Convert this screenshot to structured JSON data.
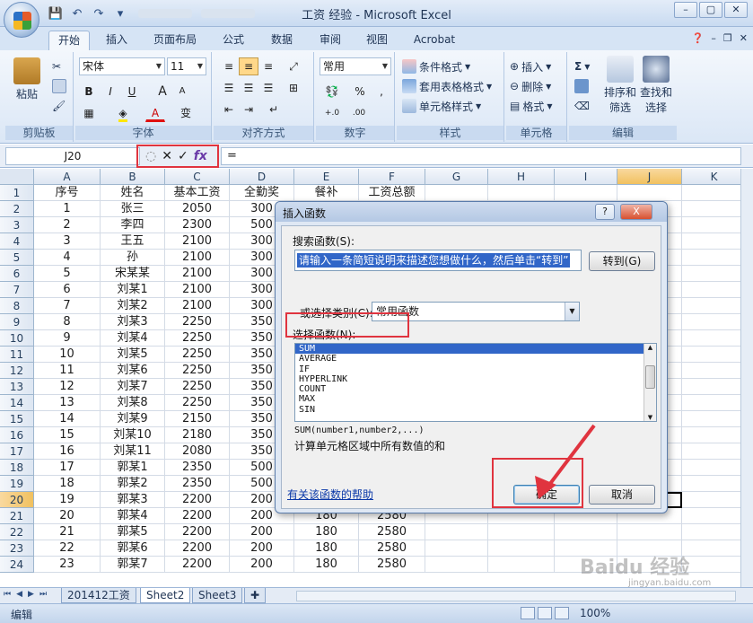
{
  "window": {
    "title": "工资 经验 - Microsoft Excel",
    "controls": [
      "–",
      "▢",
      "✕"
    ]
  },
  "ribbon": {
    "tabs": [
      "开始",
      "插入",
      "页面布局",
      "公式",
      "数据",
      "审阅",
      "视图",
      "Acrobat"
    ],
    "active_tab": "开始",
    "clipboard": {
      "paste": "粘贴",
      "label": "剪贴板"
    },
    "font": {
      "name": "宋体",
      "size": "11",
      "label": "字体",
      "bold": "B",
      "italic": "I",
      "underline": "U",
      "grow": "A",
      "shrink": "A",
      "color": "A",
      "phonetic": "变"
    },
    "alignment": {
      "label": "对齐方式"
    },
    "number": {
      "format": "常用",
      "percent": "%",
      "comma": ",",
      "inc": "+.0",
      "dec": ".00",
      "label": "数字"
    },
    "styles": {
      "conditional": "条件格式",
      "table": "套用表格格式",
      "cell": "单元格样式",
      "label": "样式"
    },
    "cells": {
      "insert": "插入",
      "delete": "删除",
      "format": "格式",
      "label": "单元格"
    },
    "editing": {
      "sigma": "Σ",
      "sort": "排序和",
      "sort2": "筛选",
      "find": "查找和",
      "find2": "选择",
      "label": "编辑"
    }
  },
  "formula_bar": {
    "name_box": "J20",
    "cancel": "✕",
    "enter": "✓",
    "fx": "fx",
    "content": "="
  },
  "sheet": {
    "columns": [
      "A",
      "B",
      "C",
      "D",
      "E",
      "F",
      "G",
      "H",
      "I",
      "J",
      "K"
    ],
    "selected_column": "J",
    "selected_row": 20,
    "headers": [
      "序号",
      "姓名",
      "基本工资",
      "全勤奖",
      "餐补",
      "工资总额"
    ],
    "rows": [
      [
        "1",
        "张三",
        "2050",
        "300",
        "",
        ""
      ],
      [
        "2",
        "李四",
        "2300",
        "500",
        "",
        ""
      ],
      [
        "3",
        "王五",
        "2100",
        "300",
        "",
        ""
      ],
      [
        "4",
        "孙",
        "2100",
        "300",
        "",
        ""
      ],
      [
        "5",
        "宋某某",
        "2100",
        "300",
        "",
        ""
      ],
      [
        "6",
        "刘某1",
        "2100",
        "300",
        "",
        ""
      ],
      [
        "7",
        "刘某2",
        "2100",
        "300",
        "",
        ""
      ],
      [
        "8",
        "刘某3",
        "2250",
        "350",
        "",
        ""
      ],
      [
        "9",
        "刘某4",
        "2250",
        "350",
        "",
        ""
      ],
      [
        "10",
        "刘某5",
        "2250",
        "350",
        "",
        ""
      ],
      [
        "11",
        "刘某6",
        "2250",
        "350",
        "",
        ""
      ],
      [
        "12",
        "刘某7",
        "2250",
        "350",
        "",
        ""
      ],
      [
        "13",
        "刘某8",
        "2250",
        "350",
        "",
        ""
      ],
      [
        "14",
        "刘某9",
        "2150",
        "350",
        "",
        ""
      ],
      [
        "15",
        "刘某10",
        "2180",
        "350",
        "",
        ""
      ],
      [
        "16",
        "刘某11",
        "2080",
        "350",
        "",
        ""
      ],
      [
        "17",
        "郭某1",
        "2350",
        "500",
        "",
        ""
      ],
      [
        "18",
        "郭某2",
        "2350",
        "500",
        "",
        ""
      ],
      [
        "19",
        "郭某3",
        "2200",
        "200",
        "",
        ""
      ],
      [
        "20",
        "郭某4",
        "2200",
        "200",
        "180",
        "2580"
      ],
      [
        "21",
        "郭某5",
        "2200",
        "200",
        "180",
        "2580"
      ],
      [
        "22",
        "郭某6",
        "2200",
        "200",
        "180",
        "2580"
      ],
      [
        "23",
        "郭某7",
        "2200",
        "200",
        "180",
        "2580"
      ]
    ],
    "tabs": [
      "201412工资",
      "Sheet2",
      "Sheet3"
    ],
    "active_tab": "Sheet2"
  },
  "status": {
    "mode": "编辑",
    "zoom": "100%"
  },
  "dialog": {
    "title": "插入函数",
    "help": "?",
    "close": "X",
    "search_label": "搜索函数(S):",
    "search_value": "请输入一条简短说明来描述您想做什么，然后单击“转到”",
    "go_button": "转到(G)",
    "category_label": "或选择类别(C):",
    "category_value": "常用函数",
    "list_label": "选择函数(N):",
    "functions": [
      "SUM",
      "AVERAGE",
      "IF",
      "HYPERLINK",
      "COUNT",
      "MAX",
      "SIN"
    ],
    "selected_function": "SUM",
    "signature": "SUM(number1,number2,...)",
    "description": "计算单元格区域中所有数值的和",
    "help_link": "有关该函数的帮助",
    "ok": "确定",
    "cancel": "取消"
  },
  "watermark": {
    "main": "Baidu 经验",
    "sub": "jingyan.baidu.com"
  },
  "colors": {
    "highlight_red": "#e0343f",
    "selection_blue": "#3166c8"
  }
}
